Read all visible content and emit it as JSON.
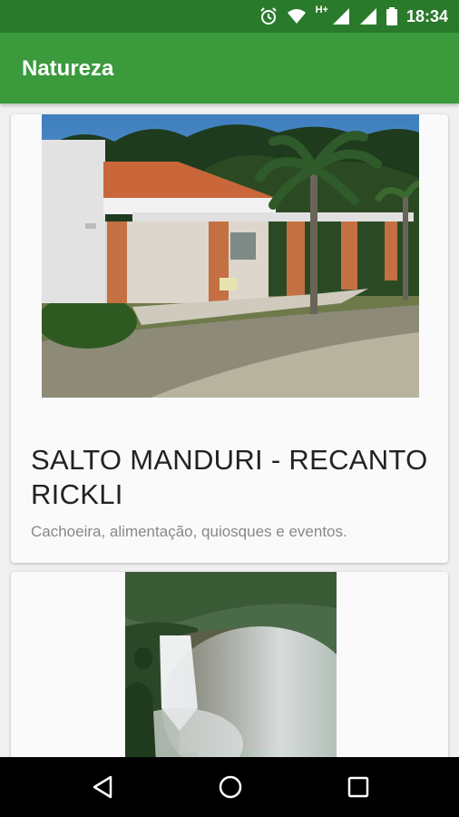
{
  "status_bar": {
    "time": "18:34",
    "network": "H+",
    "icons": [
      "alarm-icon",
      "wifi-icon",
      "signal-icon",
      "signal-icon",
      "battery-icon"
    ]
  },
  "app_bar": {
    "title": "Natureza",
    "color": "#3a9a3c"
  },
  "cards": [
    {
      "title": "SALTO MANDURI - RECANTO RICKLI",
      "description": "Cachoeira, alimentação, quiosques e eventos.",
      "image": "building-with-palm-tree-photo"
    },
    {
      "image": "waterfall-photo"
    }
  ],
  "nav_bar": {
    "icons": [
      "back-icon",
      "home-icon",
      "recents-icon"
    ]
  }
}
